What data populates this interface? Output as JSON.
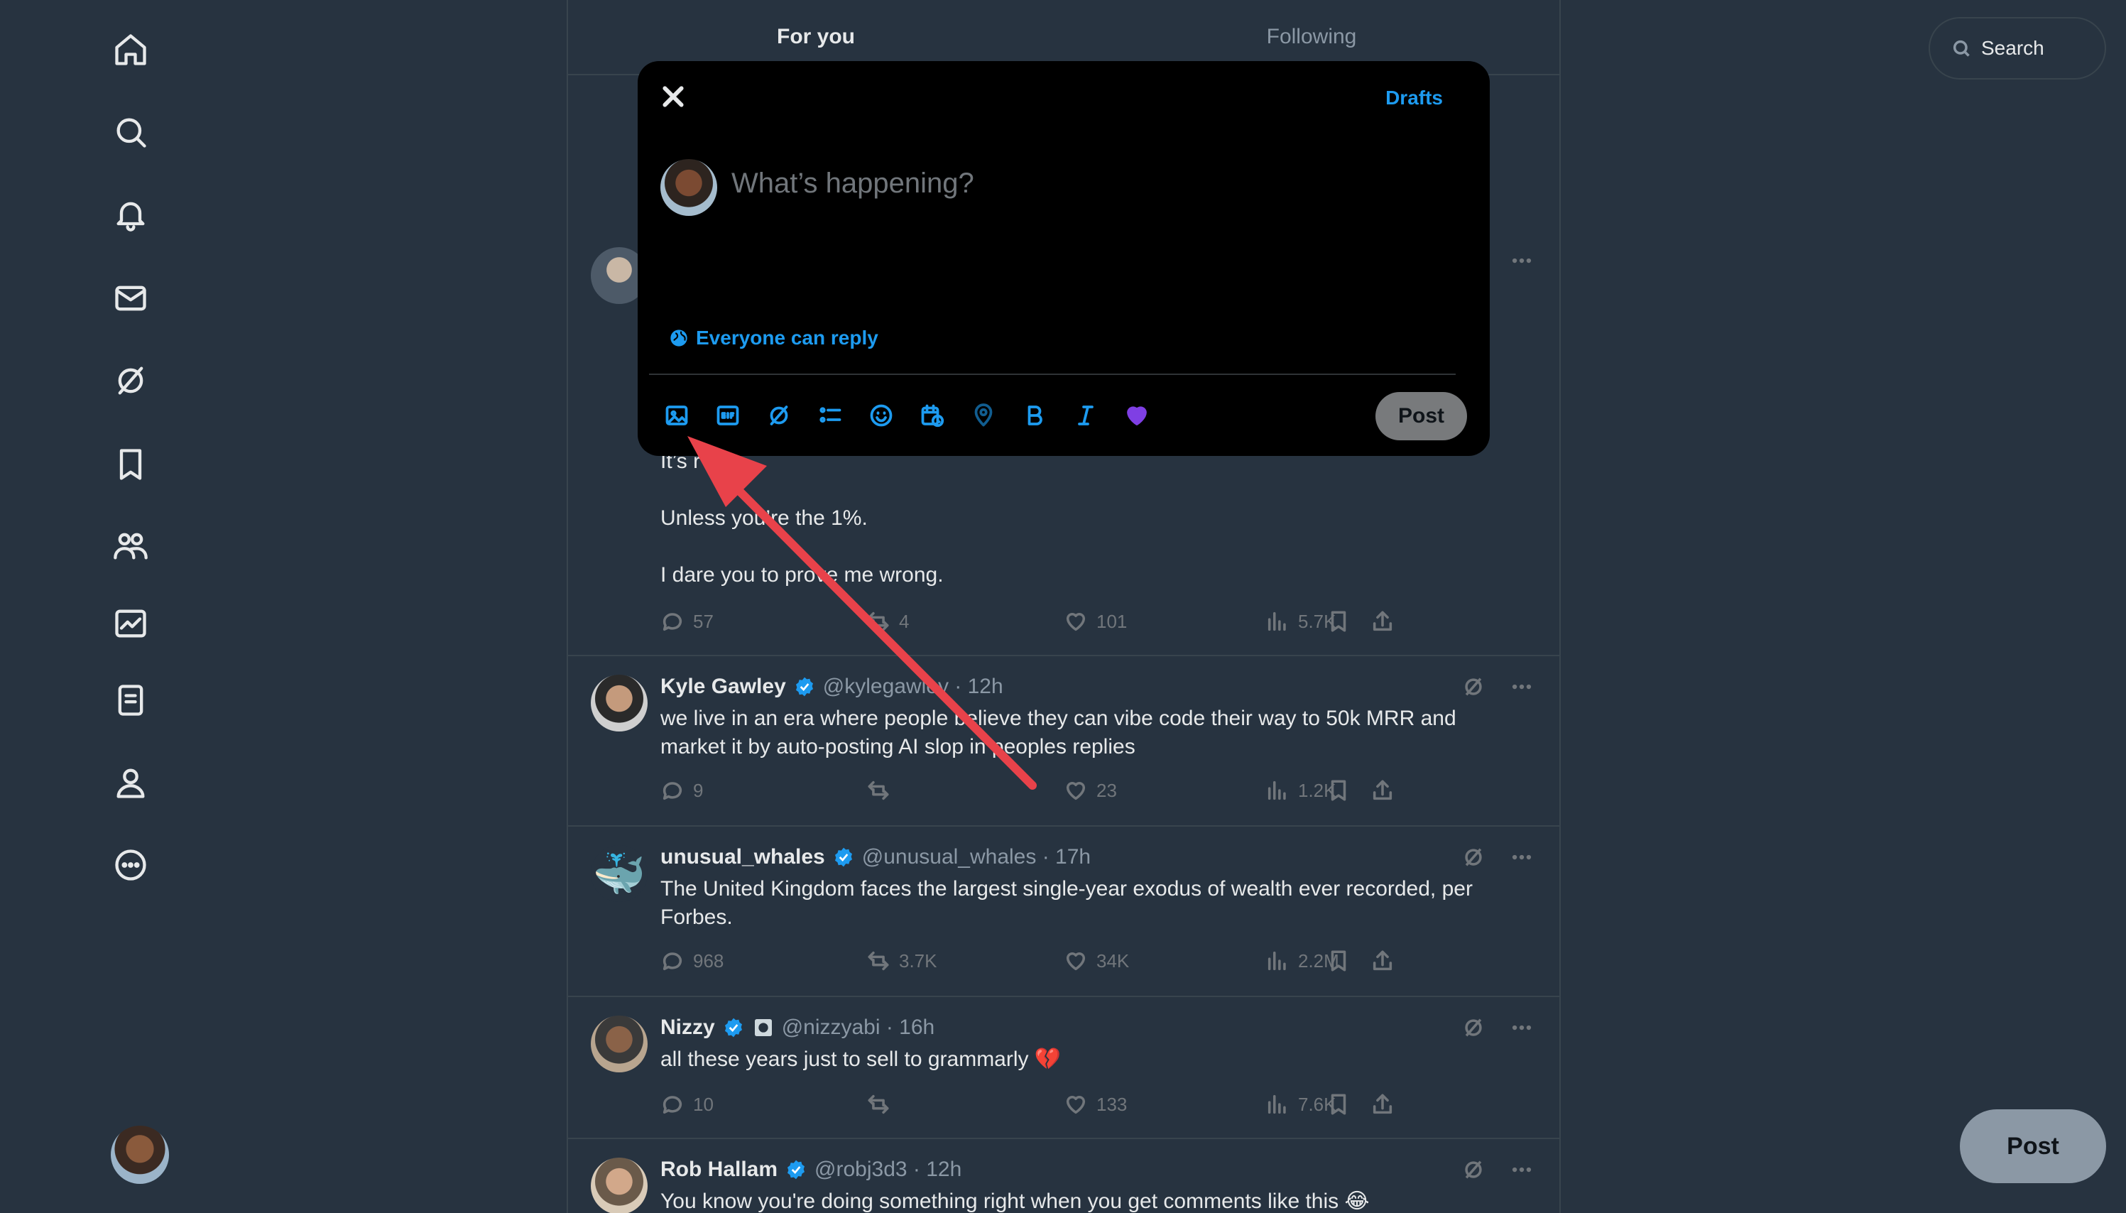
{
  "tabs": {
    "for_you": "For you",
    "following": "Following"
  },
  "search": {
    "placeholder": "Search"
  },
  "composer": {
    "drafts_label": "Drafts",
    "placeholder": "What’s happening?",
    "reply_setting": "Everyone can reply",
    "post_label": "Post",
    "toolbar_icons": [
      "image-icon",
      "gif-icon",
      "grok-icon",
      "poll-icon",
      "emoji-icon",
      "schedule-icon",
      "location-icon",
      "bold-icon",
      "italic-icon",
      "heart-icon"
    ]
  },
  "post_fab_label": "Post",
  "partial_tweet": {
    "lines": [
      "It’s r",
      "Unless you’re the 1%.",
      "I dare you to prove me wrong."
    ],
    "replies": "57",
    "reposts": "4",
    "likes": "101",
    "views": "5.7K"
  },
  "tweets": [
    {
      "name": "Kyle Gawley",
      "handle": "@kylegawley · 12h",
      "text": "we live in an era where people believe they can vibe code their way to 50k MRR and market it by auto-posting AI slop in peoples replies",
      "replies": "9",
      "reposts": "",
      "likes": "23",
      "views": "1.2K"
    },
    {
      "name": "unusual_whales",
      "handle": "@unusual_whales · 17h",
      "text": "The United Kingdom faces the largest single-year exodus of wealth ever recorded, per Forbes.",
      "replies": "968",
      "reposts": "3.7K",
      "likes": "34K",
      "views": "2.2M"
    },
    {
      "name": "Nizzy",
      "handle": "@nizzyabi · 16h",
      "text": "all these years just to sell to grammarly 💔",
      "replies": "10",
      "reposts": "",
      "likes": "133",
      "views": "7.6K"
    },
    {
      "name": "Rob Hallam",
      "handle": "@robj3d3 · 12h",
      "text": "You know you're doing something right when you get comments like this 😂"
    }
  ],
  "colors": {
    "accent": "#1d9bf0",
    "background": "#273340",
    "modal": "#000000",
    "annotation_arrow": "#e8424a"
  }
}
